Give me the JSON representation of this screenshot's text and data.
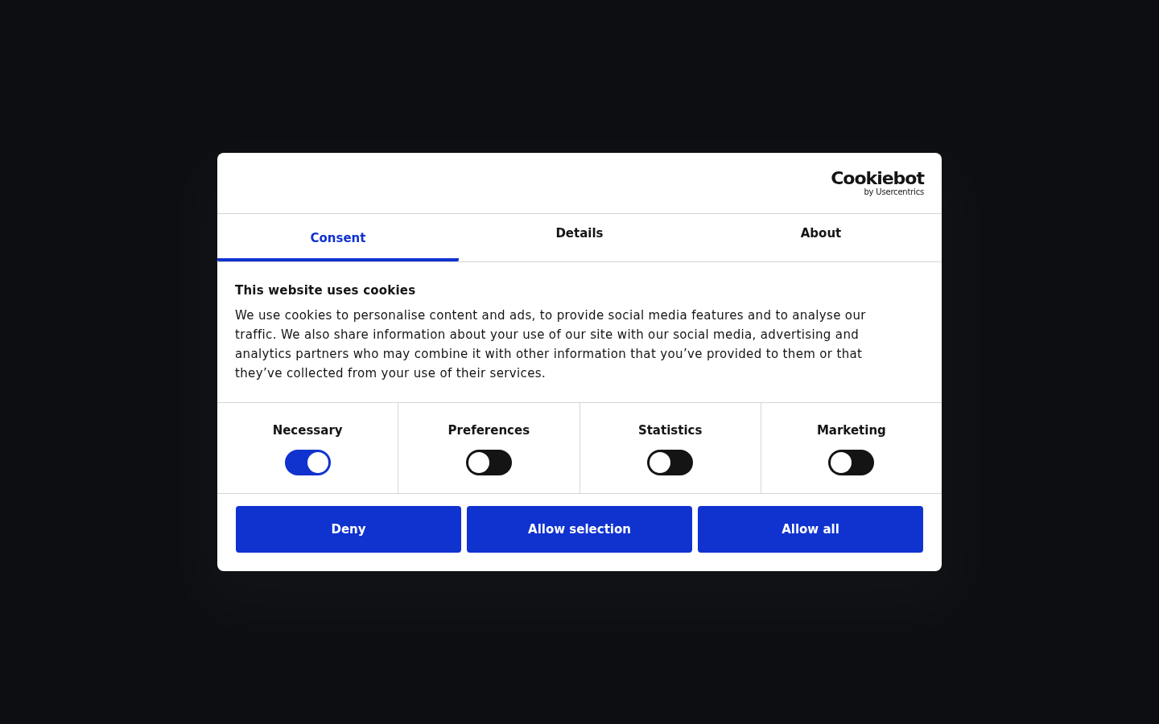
{
  "logo": {
    "name": "Cookiebot",
    "byline": "by Usercentrics"
  },
  "tabs": [
    {
      "label": "Consent",
      "selected": true
    },
    {
      "label": "Details",
      "selected": false
    },
    {
      "label": "About",
      "selected": false
    }
  ],
  "body": {
    "title": "This website uses cookies",
    "text": "We use cookies to personalise content and ads, to provide social media features and to analyse our traffic. We also share information about your use of our site with our social media, advertising and analytics partners who may combine it with other information that you’ve provided to them or that they’ve collected from your use of their services."
  },
  "categories": [
    {
      "label": "Necessary",
      "on": true
    },
    {
      "label": "Preferences",
      "on": false
    },
    {
      "label": "Statistics",
      "on": false
    },
    {
      "label": "Marketing",
      "on": false
    }
  ],
  "buttons": [
    "Deny",
    "Allow selection",
    "Allow all"
  ]
}
